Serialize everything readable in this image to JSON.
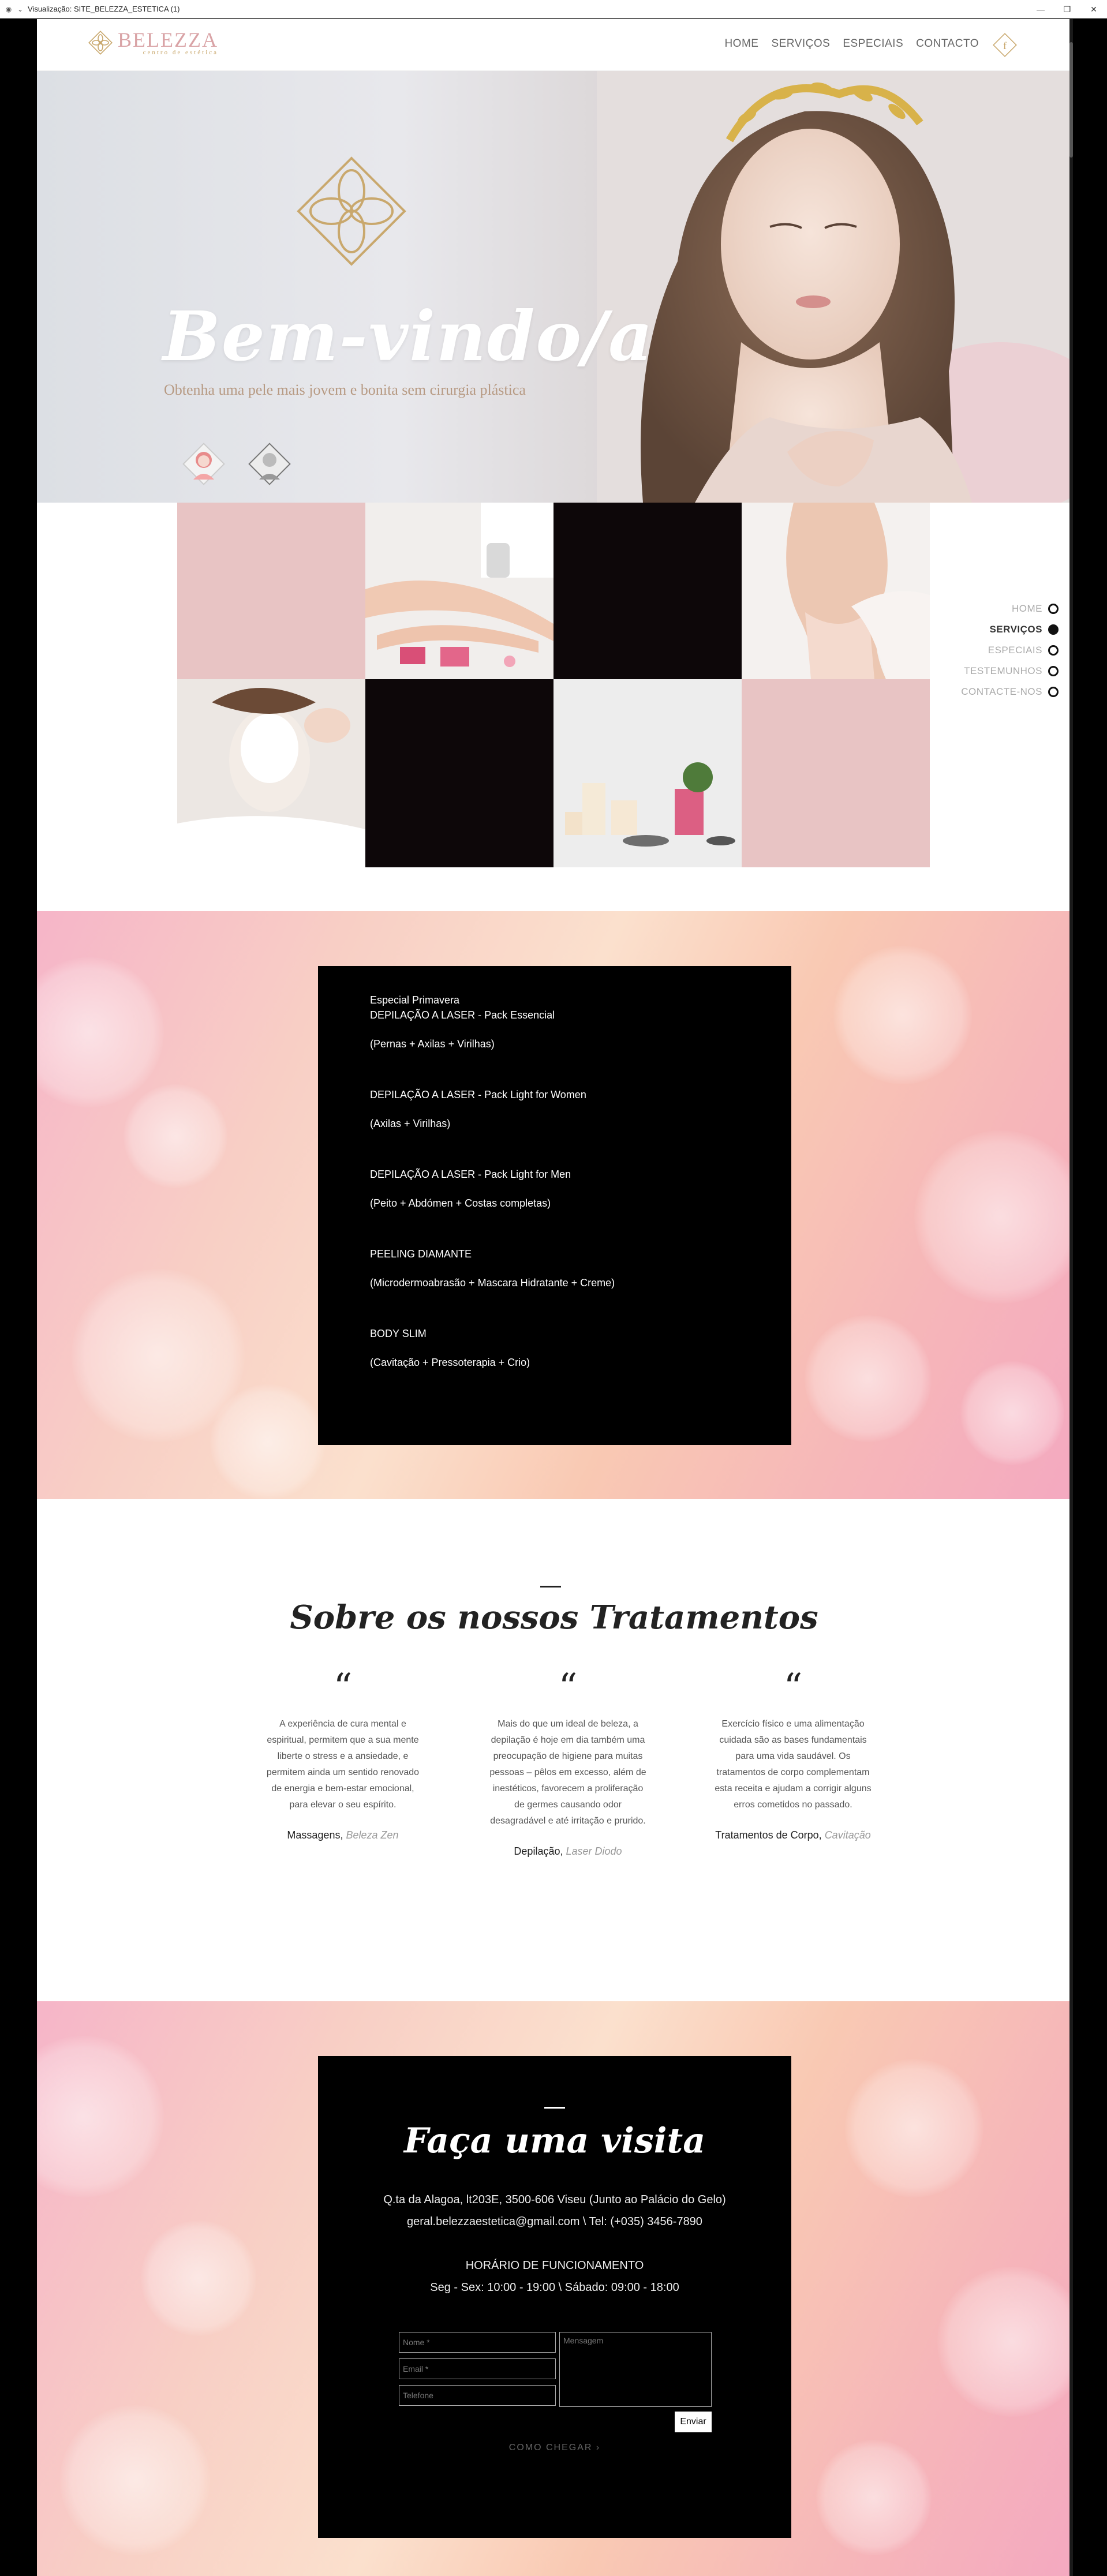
{
  "window": {
    "title": "Visualização: SITE_BELEZZA_ESTETICA (1)"
  },
  "brand": {
    "name": "BELEZZA",
    "tagline": "centro de estética"
  },
  "nav": [
    "HOME",
    "SERVIÇOS",
    "ESPECIAIS",
    "CONTACTO"
  ],
  "hero": {
    "title": "Bem-vindo/a",
    "subtitle": "Obtenha uma pele mais jovem e bonita sem cirurgia plástica"
  },
  "side_nav": [
    {
      "label": "HOME",
      "active": false
    },
    {
      "label": "SERVIÇOS",
      "active": true
    },
    {
      "label": "ESPECIAIS",
      "active": false
    },
    {
      "label": "TESTEMUNHOS",
      "active": false
    },
    {
      "label": "CONTACTE-NOS",
      "active": false
    }
  ],
  "specials": {
    "heading": "Especial Primavera",
    "items": [
      {
        "name": "DEPILAÇÃO A LASER - Pack Essencial",
        "detail": "(Pernas + Axilas + Virilhas)"
      },
      {
        "name": "DEPILAÇÃO A LASER - Pack Light for Women",
        "detail": "(Axilas + Virilhas)"
      },
      {
        "name": "DEPILAÇÃO A LASER - Pack Light for Men",
        "detail": "(Peito + Abdómen + Costas completas)"
      },
      {
        "name": "PEELING DIAMANTE",
        "detail": "(Microdermoabrasão + Mascara Hidratante + Creme)"
      },
      {
        "name": "BODY SLIM",
        "detail": "(Cavitação + Pressoterapia + Crio)"
      }
    ]
  },
  "about": {
    "title": "Sobre os nossos Tratamentos",
    "columns": [
      {
        "text": "A experiência de cura mental e espiritual, permitem que a sua mente liberte o stress e a ansiedade, e permitem ainda um sentido renovado de energia e bem-estar emocional, para elevar o seu espírito.",
        "author": "Massagens,",
        "source": "Beleza Zen"
      },
      {
        "text": "Mais do que um ideal de beleza, a depilação é hoje em dia também uma preocupação de higiene para muitas pessoas – pêlos em excesso, além de inestéticos, favorecem a proliferação de germes causando odor desagradável e até irritação e prurido.",
        "author": "Depilação,",
        "source": "Laser Diodo"
      },
      {
        "text": "Exercício físico e uma alimentação cuidada são as bases fundamentais para uma vida saudável. Os tratamentos de corpo complementam esta receita e ajudam a corrigir alguns erros cometidos no passado.",
        "author": "Tratamentos de Corpo,",
        "source": "Cavitação"
      }
    ]
  },
  "contact": {
    "title": "Faça uma visita",
    "address": "Q.ta da Alagoa, lt203E, 3500-606 Viseu (Junto ao Palácio do Gelo)",
    "email_phone": "geral.belezzaestetica@gmail.com \\  Tel: (+035) 3456-7890",
    "hours_title": "HORÁRIO DE FUNCIONAMENTO",
    "hours": "Seg - Sex: 10:00 - 19:00 \\  Sábado: 09:00 - 18:00",
    "form": {
      "name_placeholder": "Nome *",
      "email_placeholder": "Email *",
      "phone_placeholder": "Telefone",
      "message_placeholder": "Mensagem",
      "send": "Enviar"
    },
    "how_to": "COMO CHEGAR ›"
  },
  "colors": {
    "accent_pink": "#e8c4c4",
    "gold": "#c9a86d",
    "black": "#000000"
  }
}
